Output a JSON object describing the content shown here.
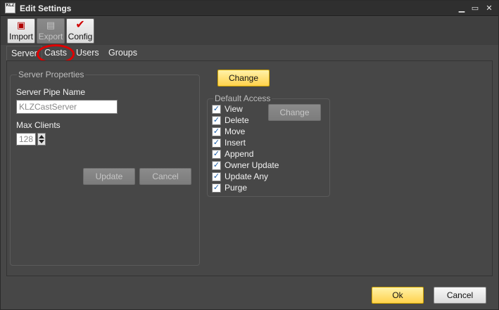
{
  "window": {
    "title": "Edit Settings",
    "app_icon_text": "KLZ"
  },
  "toolbar": {
    "import_label": "Import",
    "export_label": "Export",
    "config_label": "Config"
  },
  "tabs": [
    {
      "label": "Server",
      "active": true
    },
    {
      "label": "Casts",
      "active": false
    },
    {
      "label": "Users",
      "active": false
    },
    {
      "label": "Groups",
      "active": false
    }
  ],
  "server_properties": {
    "legend": "Server Properties",
    "pipe_name_label": "Server Pipe Name",
    "pipe_name_value": "KLZCastServer",
    "max_clients_label": "Max Clients",
    "max_clients_value": "128",
    "update_label": "Update",
    "cancel_label": "Cancel"
  },
  "change_label": "Change",
  "default_access": {
    "legend": "Default Access",
    "change_label": "Change",
    "items": [
      {
        "label": "View",
        "checked": true
      },
      {
        "label": "Delete",
        "checked": true
      },
      {
        "label": "Move",
        "checked": true
      },
      {
        "label": "Insert",
        "checked": true
      },
      {
        "label": "Append",
        "checked": true
      },
      {
        "label": "Owner Update",
        "checked": true
      },
      {
        "label": "Update Any",
        "checked": true
      },
      {
        "label": "Purge",
        "checked": true
      }
    ]
  },
  "footer": {
    "ok_label": "Ok",
    "cancel_label": "Cancel"
  },
  "colors": {
    "accent_yellow": "#ffd24d",
    "highlight_red": "#e00000"
  }
}
